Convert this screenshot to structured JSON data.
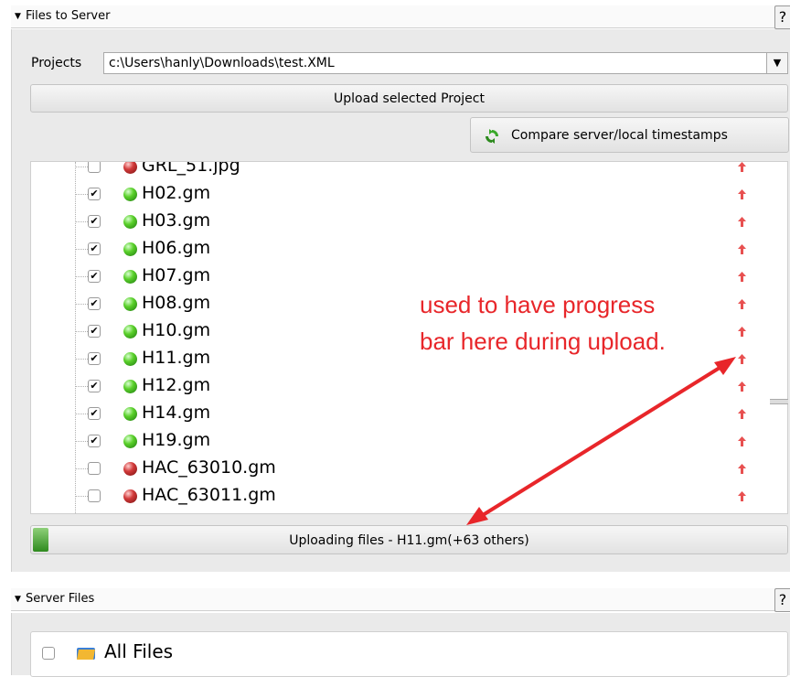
{
  "files_panel": {
    "title": "Files to Server",
    "help": "?",
    "projects_label": "Projects",
    "projects_value": "c:\\Users\\hanly\\Downloads\\test.XML",
    "upload_button": "Upload selected Project",
    "compare_button": "Compare server/local timestamps",
    "compare_icon": "refresh-icon",
    "files": [
      {
        "name": "GRL_51.jpg",
        "checked": false,
        "status": "red"
      },
      {
        "name": "H02.gm",
        "checked": true,
        "status": "green"
      },
      {
        "name": "H03.gm",
        "checked": true,
        "status": "green"
      },
      {
        "name": "H06.gm",
        "checked": true,
        "status": "green"
      },
      {
        "name": "H07.gm",
        "checked": true,
        "status": "green"
      },
      {
        "name": "H08.gm",
        "checked": true,
        "status": "green"
      },
      {
        "name": "H10.gm",
        "checked": true,
        "status": "green"
      },
      {
        "name": "H11.gm",
        "checked": true,
        "status": "green"
      },
      {
        "name": "H12.gm",
        "checked": true,
        "status": "green"
      },
      {
        "name": "H14.gm",
        "checked": true,
        "status": "green"
      },
      {
        "name": "H19.gm",
        "checked": true,
        "status": "green"
      },
      {
        "name": "HAC_63010.gm",
        "checked": false,
        "status": "red"
      },
      {
        "name": "HAC_63011.gm",
        "checked": false,
        "status": "red"
      }
    ],
    "progress_text": "Uploading files - H11.gm(+63 others)",
    "progress_fraction": 0.02
  },
  "annotation": {
    "line1": "used to have progress",
    "line2": "bar here during upload.",
    "color": "#e8262a"
  },
  "server_panel": {
    "title": "Server Files",
    "help": "?",
    "root_label": "All Files",
    "root_icon": "folder-icon"
  }
}
